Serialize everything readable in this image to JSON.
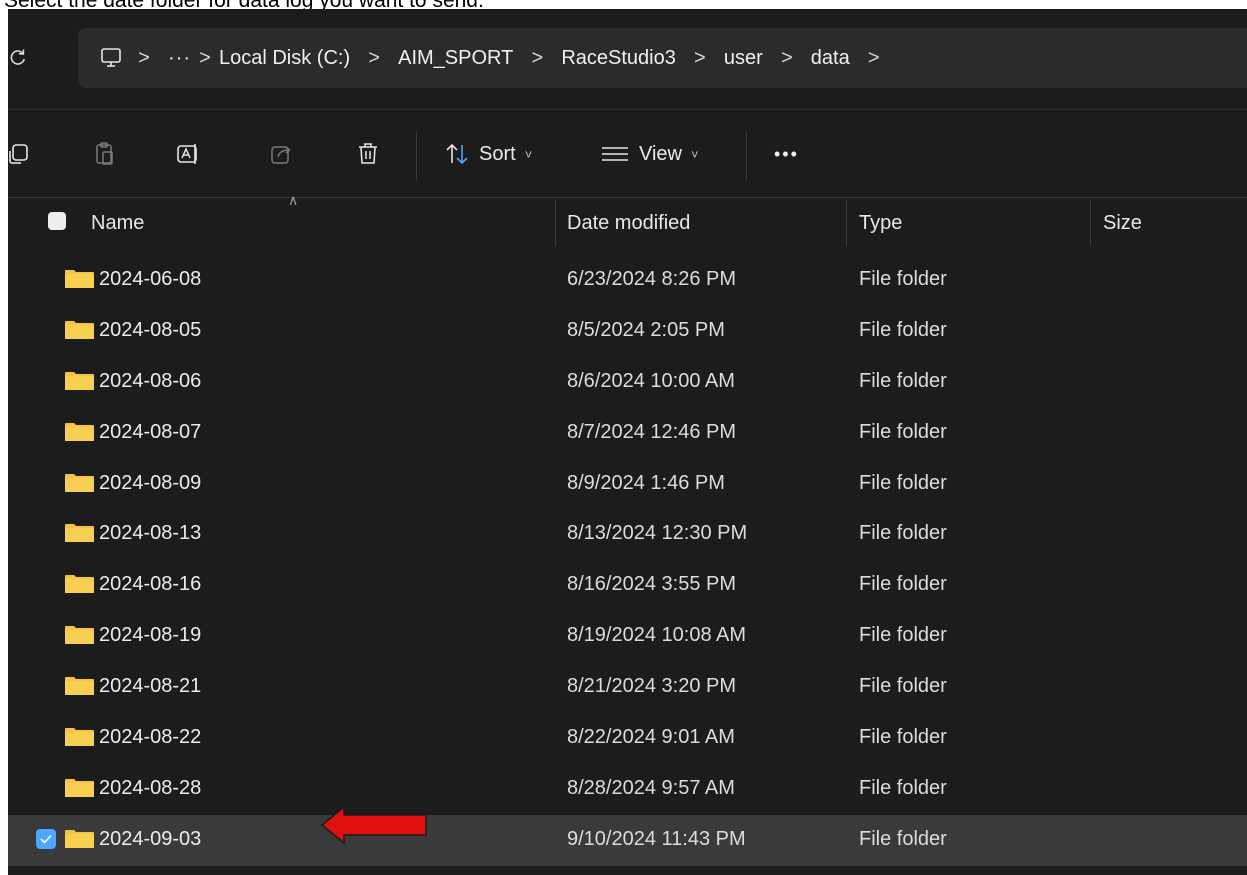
{
  "instruction": "Select the date folder for data log you want to send.",
  "address_bar": {
    "ellipsis": "···",
    "separator": ">",
    "segments": [
      "Local Disk (C:)",
      "AIM_SPORT",
      "RaceStudio3",
      "user",
      "data"
    ]
  },
  "toolbar": {
    "sort_label": "Sort",
    "view_label": "View",
    "more_label": "•••",
    "caret": "˅"
  },
  "columns": {
    "name": "Name",
    "date_modified": "Date modified",
    "type": "Type",
    "size": "Size"
  },
  "rows": [
    {
      "name": "2024-06-08",
      "date": "6/23/2024 8:26 PM",
      "type": "File folder"
    },
    {
      "name": "2024-08-05",
      "date": "8/5/2024 2:05 PM",
      "type": "File folder"
    },
    {
      "name": "2024-08-06",
      "date": "8/6/2024 10:00 AM",
      "type": "File folder"
    },
    {
      "name": "2024-08-07",
      "date": "8/7/2024 12:46 PM",
      "type": "File folder"
    },
    {
      "name": "2024-08-09",
      "date": "8/9/2024 1:46 PM",
      "type": "File folder"
    },
    {
      "name": "2024-08-13",
      "date": "8/13/2024 12:30 PM",
      "type": "File folder"
    },
    {
      "name": "2024-08-16",
      "date": "8/16/2024 3:55 PM",
      "type": "File folder"
    },
    {
      "name": "2024-08-19",
      "date": "8/19/2024 10:08 AM",
      "type": "File folder"
    },
    {
      "name": "2024-08-21",
      "date": "8/21/2024 3:20 PM",
      "type": "File folder"
    },
    {
      "name": "2024-08-22",
      "date": "8/22/2024 9:01 AM",
      "type": "File folder"
    },
    {
      "name": "2024-08-28",
      "date": "8/28/2024 9:57 AM",
      "type": "File folder"
    },
    {
      "name": "2024-09-03",
      "date": "9/10/2024 11:43 PM",
      "type": "File folder"
    }
  ],
  "colors": {
    "background": "#1c1c1c",
    "selected_row": "#3a3a3a",
    "checkbox_accent": "#4ea6ff",
    "folder": "#f5c542",
    "annotation_arrow": "#e01010"
  }
}
